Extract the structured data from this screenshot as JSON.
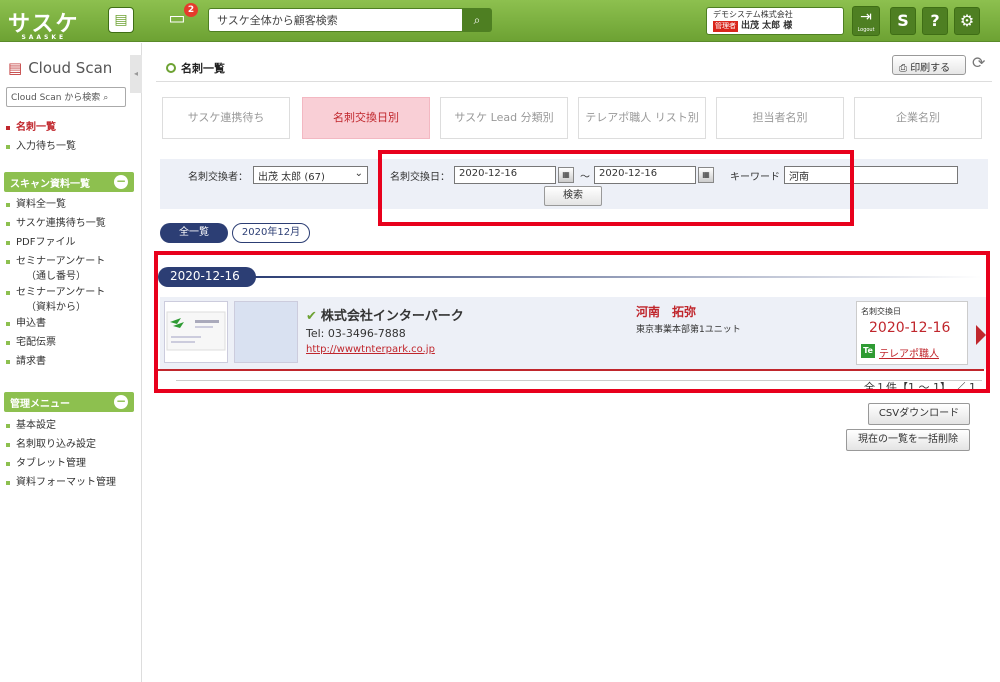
{
  "topbar": {
    "logo_text": "サスケ",
    "logo_sub": "SAASKE",
    "notification_count": "2",
    "search_placeholder": "サスケ全体から顧客検索",
    "company_name": "デモシステム株式会社",
    "admin_badge": "管理者",
    "user_name": "出茂 太郎 様",
    "logout_label": "Logout",
    "help_label": "?"
  },
  "sidebar": {
    "title": "Cloud Scan",
    "search_placeholder": "Cloud Scan から検索",
    "top_items": [
      "名刺一覧",
      "入力待ち一覧"
    ],
    "scan_section": "スキャン資料一覧",
    "scan_items": [
      "資料全一覧",
      "サスケ連携待ち一覧",
      "PDFファイル"
    ],
    "seminar1_line1": "セミナーアンケート",
    "seminar1_line2": "（通し番号）",
    "seminar2_line1": "セミナーアンケート",
    "seminar2_line2": "（資料から）",
    "scan_items_2": [
      "申込書",
      "宅配伝票",
      "請求書"
    ],
    "admin_section": "管理メニュー",
    "admin_items": [
      "基本設定",
      "名刺取り込み設定",
      "タブレット管理",
      "資料フォーマット管理"
    ]
  },
  "main": {
    "page_title": "名刺一覧",
    "print_label": "印刷する",
    "tabs": [
      "サスケ連携待ち",
      "名刺交換日別",
      "サスケ Lead 分類別",
      "テレアポ職人 リスト別",
      "担当者名別",
      "企業名別"
    ],
    "active_tab": "名刺交換日別"
  },
  "filter": {
    "exchanger_label": "名刺交換者：",
    "exchanger_value": "出茂 太郎 (67)",
    "date_label": "名刺交換日：",
    "date_from": "2020-12-16",
    "tilde": "～",
    "date_to": "2020-12-16",
    "keyword_label": "キーワード",
    "keyword_value": "河南",
    "search_button": "検索"
  },
  "pills": {
    "all": "全一覧",
    "month": "2020年12月"
  },
  "group_date": "2020-12-16",
  "card": {
    "company": "株式会社インターパーク",
    "tel": "Tel: 03-3496-7888",
    "url": "http://wwwtnterpark.co.jp",
    "person": "河南　拓弥",
    "department": "東京事業本部第1ユニット",
    "exchange_label": "名刺交換日",
    "exchange_date": "2020-12-16",
    "tele_badge": "Te",
    "tele_link": "テレアポ職人"
  },
  "pagination": {
    "text": "全１件【1 ～ 1】 ／ 1"
  },
  "buttons": {
    "csv": "CSVダウンロード",
    "delete_all": "現在の一覧を一括削除"
  },
  "colors": {
    "brand_green": "#6da233",
    "active_red": "#c0262c",
    "navy": "#2c3e74",
    "highlight_red": "#e8001c"
  }
}
